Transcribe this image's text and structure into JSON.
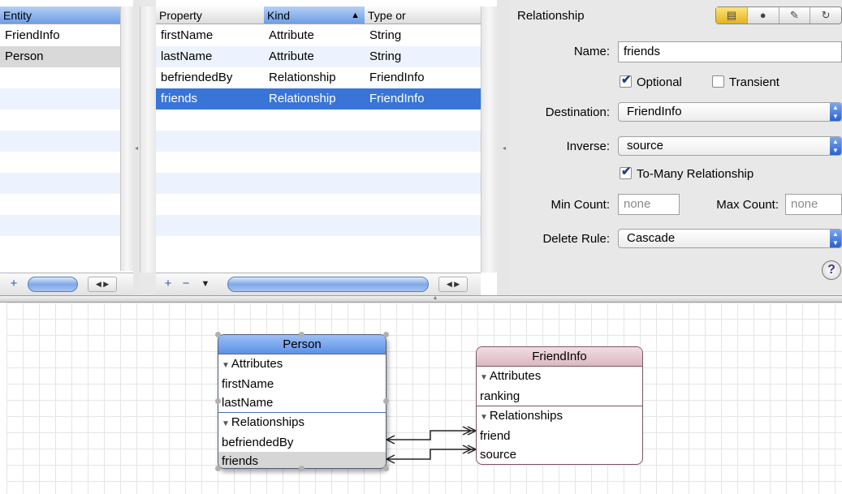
{
  "entity_table": {
    "header": "Entity",
    "rows": [
      "FriendInfo",
      "Person"
    ],
    "selected_index": 1
  },
  "property_table": {
    "headers": {
      "property": "Property",
      "kind": "Kind",
      "type": "Type or"
    },
    "sort_indicator": "▲",
    "rows": [
      {
        "property": "firstName",
        "kind": "Attribute",
        "type": "String"
      },
      {
        "property": "lastName",
        "kind": "Attribute",
        "type": "String"
      },
      {
        "property": "befriendedBy",
        "kind": "Relationship",
        "type": "FriendInfo"
      },
      {
        "property": "friends",
        "kind": "Relationship",
        "type": "FriendInfo"
      }
    ],
    "selected_index": 3
  },
  "toolbar_glyphs": {
    "add": "+",
    "remove": "−",
    "menu": "▼",
    "left": "◀",
    "right": "▶"
  },
  "inspector": {
    "title": "Relationship",
    "name_label": "Name:",
    "name_value": "friends",
    "optional_label": "Optional",
    "optional_checked": true,
    "transient_label": "Transient",
    "transient_checked": false,
    "destination_label": "Destination:",
    "destination_value": "FriendInfo",
    "inverse_label": "Inverse:",
    "inverse_value": "source",
    "to_many_label": "To-Many Relationship",
    "to_many_checked": true,
    "min_count_label": "Min Count:",
    "min_count_placeholder": "none",
    "max_count_label": "Max Count:",
    "max_count_placeholder": "none",
    "delete_rule_label": "Delete Rule:",
    "delete_rule_value": "Cascade",
    "help": "?"
  },
  "diagram": {
    "person": {
      "title": "Person",
      "attributes_label": "Attributes",
      "attributes": [
        "firstName",
        "lastName"
      ],
      "relationships_label": "Relationships",
      "relationships": [
        "befriendedBy",
        "friends"
      ]
    },
    "friendinfo": {
      "title": "FriendInfo",
      "attributes_label": "Attributes",
      "attributes": [
        "ranking"
      ],
      "relationships_label": "Relationships",
      "relationships": [
        "friend",
        "source"
      ]
    }
  },
  "colors": {
    "selection_blue": "#3875d7",
    "person_header": "#6f9ee8",
    "friendinfo_header": "#e6c9d0"
  }
}
